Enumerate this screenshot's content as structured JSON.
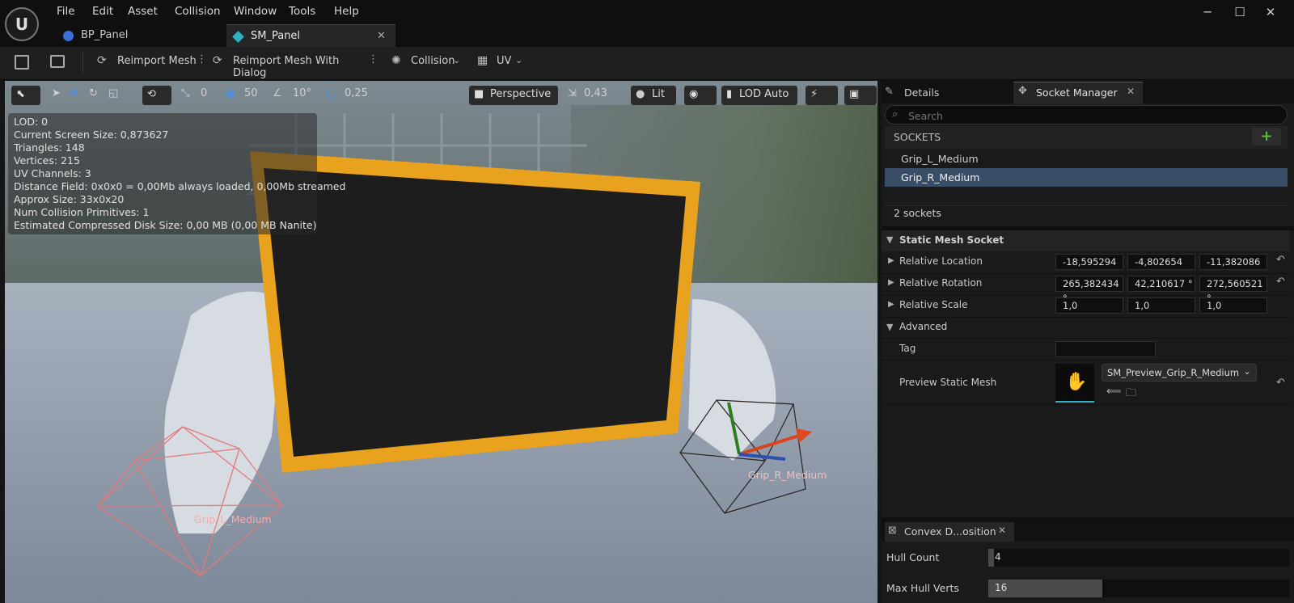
{
  "menu": [
    "File",
    "Edit",
    "Asset",
    "Collision",
    "Window",
    "Tools",
    "Help"
  ],
  "tabs": [
    {
      "label": "BP_Panel",
      "active": false
    },
    {
      "label": "SM_Panel",
      "active": true
    }
  ],
  "window_controls": {
    "minimize": "─",
    "maximize": "☐",
    "close": "✕"
  },
  "toolbar": {
    "reimport": "Reimport Mesh",
    "reimport_dialog": "Reimport Mesh With Dialog",
    "collision": "Collision",
    "uv": "UV"
  },
  "viewport_toolbar": {
    "rotation_snap_value": "0",
    "grid_snap": "50",
    "angle_snap": "10°",
    "scale_snap": "0,25",
    "view_mode": "Perspective",
    "camera_speed": "0,43",
    "lighting": "Lit",
    "lod": "LOD Auto"
  },
  "stats": [
    "LOD:  0",
    "Current Screen Size:  0,873627",
    "Triangles:  148",
    "Vertices:  215",
    "UV Channels:  3",
    "Distance Field:  0x0x0 = 0,00Mb always loaded, 0,00Mb streamed",
    "Approx Size: 33x0x20",
    "Num Collision Primitives:  1",
    "Estimated Compressed Disk Size: 0,00 MB (0,00 MB Nanite)"
  ],
  "viewport_labels": {
    "left_socket": "Grip_L_Medium",
    "right_socket": "Grip_R_Medium"
  },
  "panel_tabs": {
    "details": "Details",
    "socket_manager": "Socket Manager"
  },
  "search": {
    "placeholder": "Search"
  },
  "sockets": {
    "header": "SOCKETS",
    "items": [
      "Grip_L_Medium",
      "Grip_R_Medium"
    ],
    "selected": "Grip_R_Medium",
    "count": "2 sockets"
  },
  "details": {
    "section": "Static Mesh Socket",
    "relative_location": {
      "label": "Relative Location",
      "x": "-18,595294",
      "y": "-4,802654",
      "z": "-11,382086"
    },
    "relative_rotation": {
      "label": "Relative Rotation",
      "x": "265,382434 °",
      "y": "42,210617 °",
      "z": "272,560521 °"
    },
    "relative_scale": {
      "label": "Relative Scale",
      "x": "1,0",
      "y": "1,0",
      "z": "1,0"
    },
    "advanced": "Advanced",
    "tag": {
      "label": "Tag",
      "value": ""
    },
    "preview_mesh": {
      "label": "Preview Static Mesh",
      "value": "SM_Preview_Grip_R_Medium"
    }
  },
  "convex": {
    "tab": "Convex D...osition",
    "hull_count": {
      "label": "Hull Count",
      "value": "4",
      "fill": 0.02
    },
    "max_hull_verts": {
      "label": "Max Hull Verts",
      "value": "16",
      "fill": 0.38
    }
  },
  "colors": {
    "accent_blue": "#3a7bd5",
    "frame_yellow": "#e8a21e",
    "selected_row": "#3a4d66",
    "add_green": "#5cbf3a"
  }
}
